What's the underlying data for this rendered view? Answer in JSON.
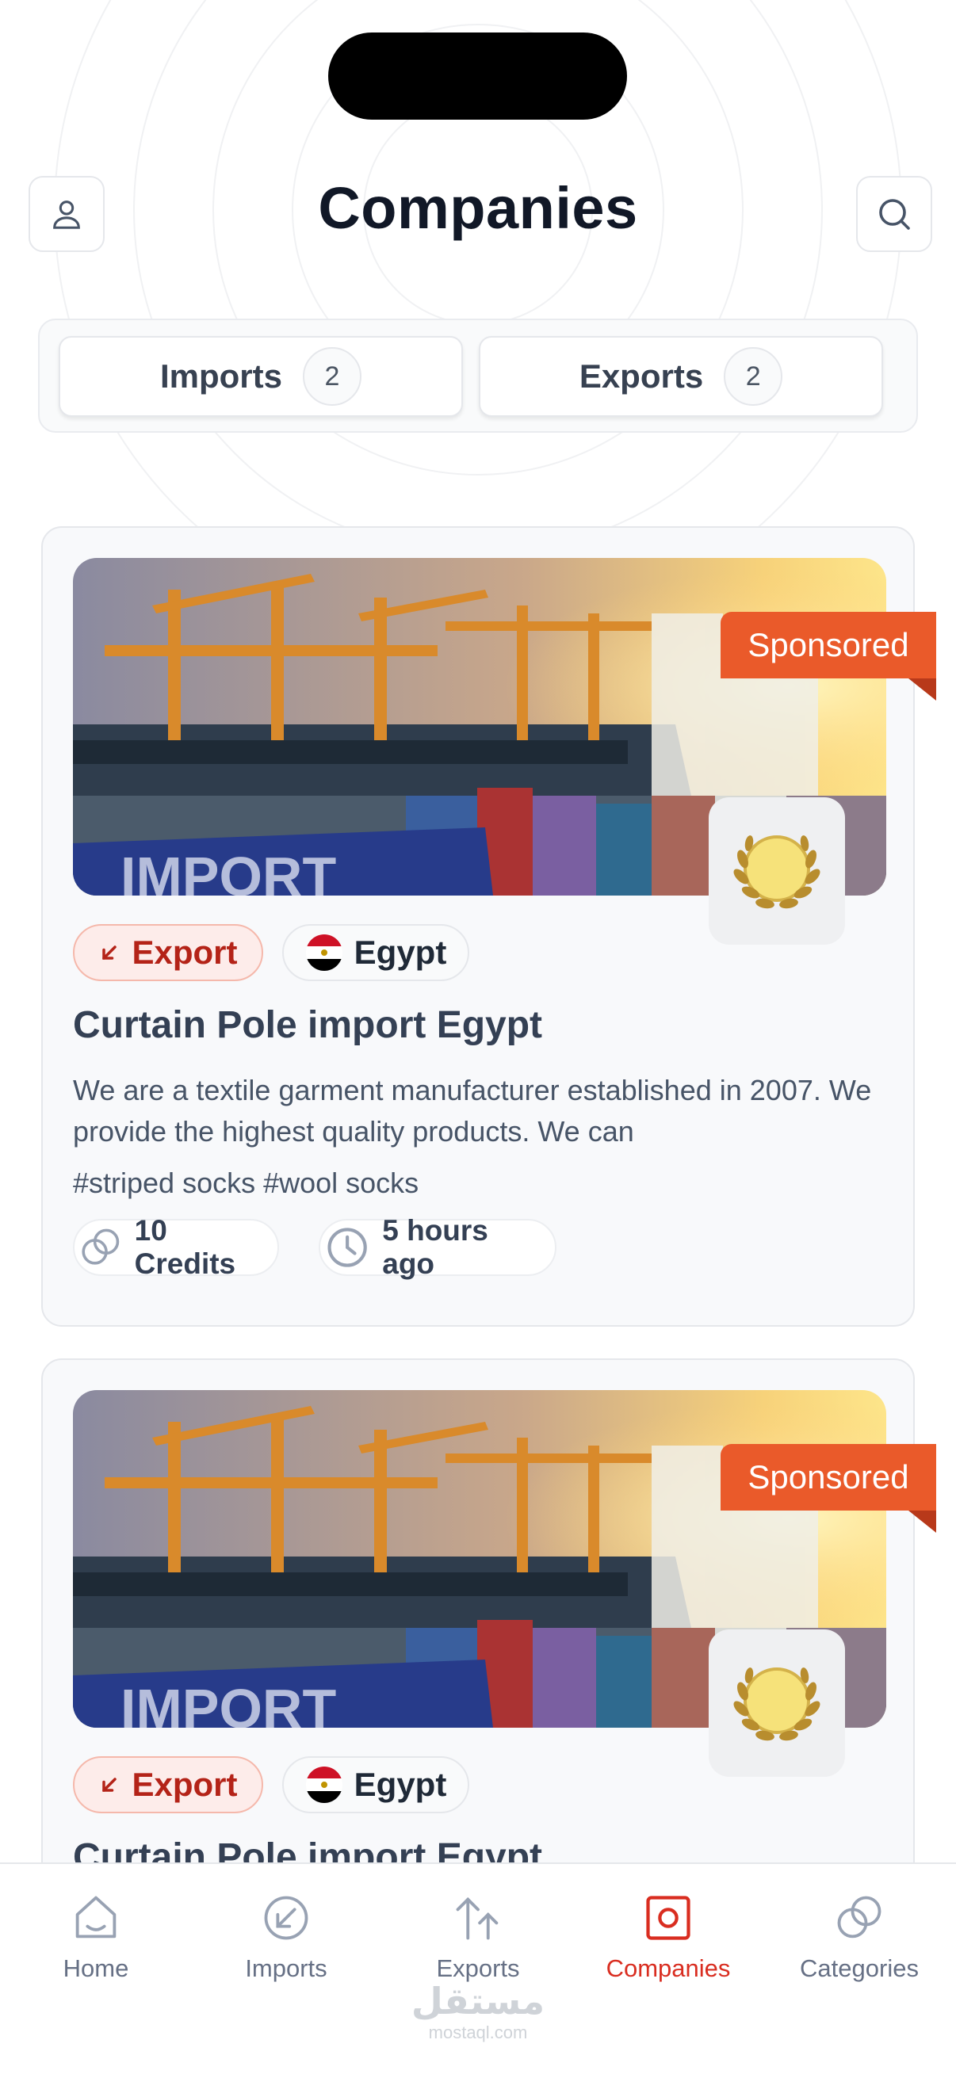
{
  "header": {
    "title": "Companies"
  },
  "tabs": [
    {
      "label": "Imports",
      "count": "2"
    },
    {
      "label": "Exports",
      "count": "2"
    }
  ],
  "cards": [
    {
      "sponsored": "Sponsored",
      "type": "Export",
      "country": "Egypt",
      "title": "Curtain Pole import Egypt",
      "description": "We are a textile garment manufacturer established in 2007. We provide the highest quality products. We can",
      "tags": "#striped socks #wool socks",
      "credits": "10 Credits",
      "time": "5 hours ago"
    },
    {
      "sponsored": "Sponsored",
      "type": "Export",
      "country": "Egypt",
      "title": "Curtain Pole import Egypt"
    }
  ],
  "nav": [
    {
      "label": "Home",
      "icon": "home-icon",
      "active": false
    },
    {
      "label": "Imports",
      "icon": "import-arrow-icon",
      "active": false
    },
    {
      "label": "Exports",
      "icon": "export-arrow-icon",
      "active": false
    },
    {
      "label": "Companies",
      "icon": "companies-icon",
      "active": true
    },
    {
      "label": "Categories",
      "icon": "categories-icon",
      "active": false
    }
  ],
  "watermark": {
    "arabic": "مستقل",
    "latin": "mostaql.com"
  },
  "colors": {
    "accent": "#d92d20",
    "sponsored": "#ea5a2a",
    "export_pill_bg": "#fdecea",
    "export_pill_text": "#b42318"
  }
}
